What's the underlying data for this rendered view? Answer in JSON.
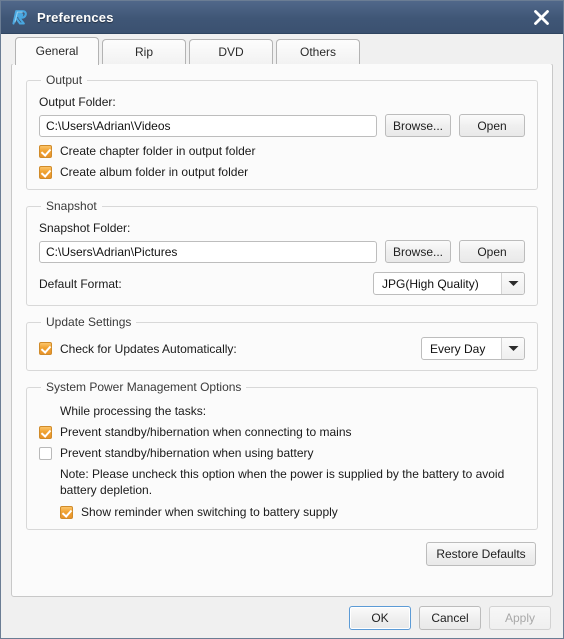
{
  "window": {
    "title": "Preferences",
    "logo_icon": "app-logo-r-icon",
    "close_icon": "close-icon",
    "accent_color": "#3f5676",
    "checkbox_color": "#e8922a"
  },
  "tabs": [
    {
      "label": "General",
      "active": true
    },
    {
      "label": "Rip",
      "active": false
    },
    {
      "label": "DVD",
      "active": false
    },
    {
      "label": "Others",
      "active": false
    }
  ],
  "output": {
    "group_title": "Output",
    "folder_label": "Output Folder:",
    "folder_value": "C:\\Users\\Adrian\\Videos",
    "browse_label": "Browse...",
    "open_label": "Open",
    "checkboxes": [
      {
        "label": "Create chapter folder in output folder",
        "checked": true
      },
      {
        "label": "Create album folder in output folder",
        "checked": true
      }
    ]
  },
  "snapshot": {
    "group_title": "Snapshot",
    "folder_label": "Snapshot Folder:",
    "folder_value": "C:\\Users\\Adrian\\Pictures",
    "browse_label": "Browse...",
    "open_label": "Open",
    "format_label": "Default Format:",
    "format_value": "JPG(High Quality)"
  },
  "update": {
    "group_title": "Update Settings",
    "check_label": "Check for Updates Automatically:",
    "check_checked": true,
    "frequency_value": "Every Day"
  },
  "power": {
    "group_title": "System Power Management Options",
    "intro": "While processing the tasks:",
    "mains_label": "Prevent standby/hibernation when connecting to mains",
    "mains_checked": true,
    "battery_label": "Prevent standby/hibernation when using battery",
    "battery_checked": false,
    "note": "Note: Please uncheck this option when the power is supplied by the battery to avoid battery depletion.",
    "reminder_label": "Show reminder when switching to battery supply",
    "reminder_checked": true
  },
  "restore": {
    "label": "Restore Defaults"
  },
  "footer": {
    "ok_label": "OK",
    "cancel_label": "Cancel",
    "apply_label": "Apply",
    "apply_disabled": true
  }
}
